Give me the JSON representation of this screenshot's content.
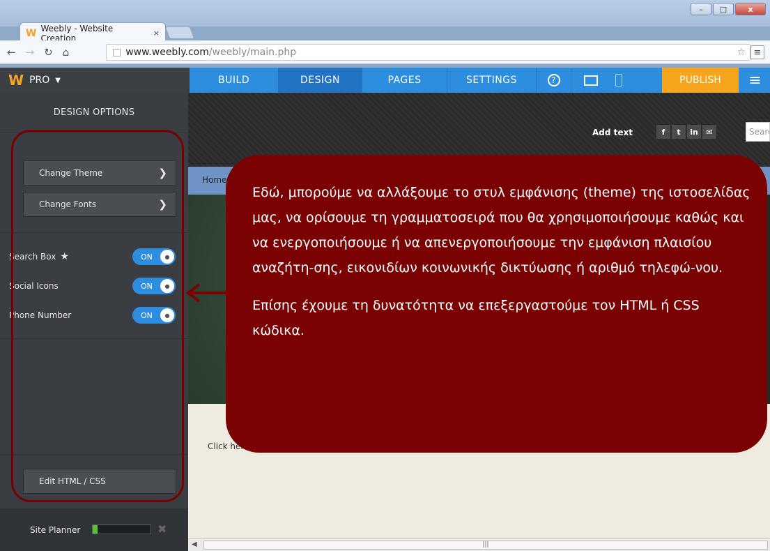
{
  "browser": {
    "tab_title": "Weebly - Website Creation",
    "tab_close": "×",
    "url_host": "www.weebly.com",
    "url_path": "/weebly/main.php",
    "window_buttons": [
      "–",
      "□",
      "x"
    ]
  },
  "weebly": {
    "brand_logo": "W",
    "plan": "PRO",
    "nav": [
      "BUILD",
      "DESIGN",
      "PAGES",
      "SETTINGS"
    ],
    "active_nav": "DESIGN",
    "help": "?",
    "publish": "PUBLISH",
    "colors": {
      "bar": "#2d8ee0",
      "publish": "#f7a51c",
      "sidebar": "#3a3d41"
    }
  },
  "sidebar": {
    "title": "DESIGN OPTIONS",
    "buttons": [
      {
        "label": "Change Theme"
      },
      {
        "label": "Change Fonts"
      }
    ],
    "toggles": [
      {
        "label": "Search Box",
        "state": "ON",
        "star": "★"
      },
      {
        "label": "Social Icons",
        "state": "ON"
      },
      {
        "label": "Phone Number",
        "state": "ON"
      }
    ],
    "edit_button": "Edit HTML / CSS",
    "site_planner": {
      "label": "Site Planner",
      "progress": 0.08,
      "close": "✖"
    }
  },
  "site": {
    "add_text": "Add text",
    "social": [
      "f",
      "t",
      "in",
      "✉"
    ],
    "search_placeholder": "Search",
    "nav_home": "Home",
    "click_here": "Click here"
  },
  "annotation": {
    "paragraph1": "Εδώ, μπορούμε να αλλάξουμε το στυλ εμφάνισης (theme) της ιστοσελίδας μας, να ορίσουμε τη γραμματοσειρά που θα χρησιμοποιήσουμε καθώς και να ενεργοποιήσουμε ή να απενεργοποιήσουμε την εμφάνιση πλαισίου αναζήτη-σης, εικονιδίων κοινωνικής δικτύωσης ή αριθμό τηλεφώ-νου.",
    "paragraph2": "Επίσης έχουμε τη δυνατότητα να επεξεργαστούμε τον HTML ή CSS κώδικα.",
    "color": "#7a0202"
  }
}
